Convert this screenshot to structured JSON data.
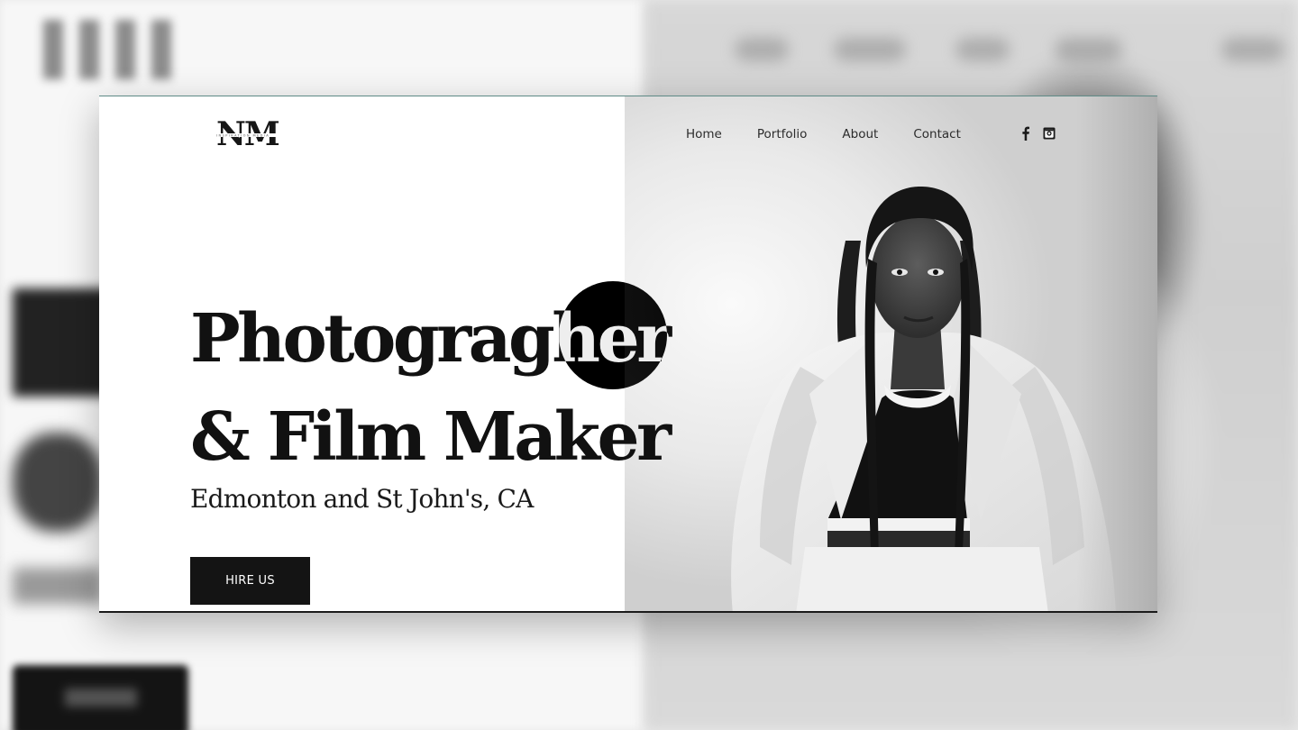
{
  "brand": {
    "logo_text": "NM",
    "logo_tagline": "INSPIRATION MEDIA"
  },
  "nav": {
    "items": [
      {
        "label": "Home"
      },
      {
        "label": "Portfolio"
      },
      {
        "label": "About"
      },
      {
        "label": "Contact"
      }
    ]
  },
  "social": {
    "icons": [
      "facebook-icon",
      "instagram-icon"
    ]
  },
  "hero": {
    "title_line1": "Photogragher",
    "title_line2": "& Film Maker",
    "subtitle": "Edmonton and St John's, CA",
    "cta_label": "HIRE US"
  },
  "colors": {
    "text_dark": "#111111",
    "button_bg": "#141414",
    "button_text": "#ffffff",
    "card_bg": "#ffffff"
  }
}
